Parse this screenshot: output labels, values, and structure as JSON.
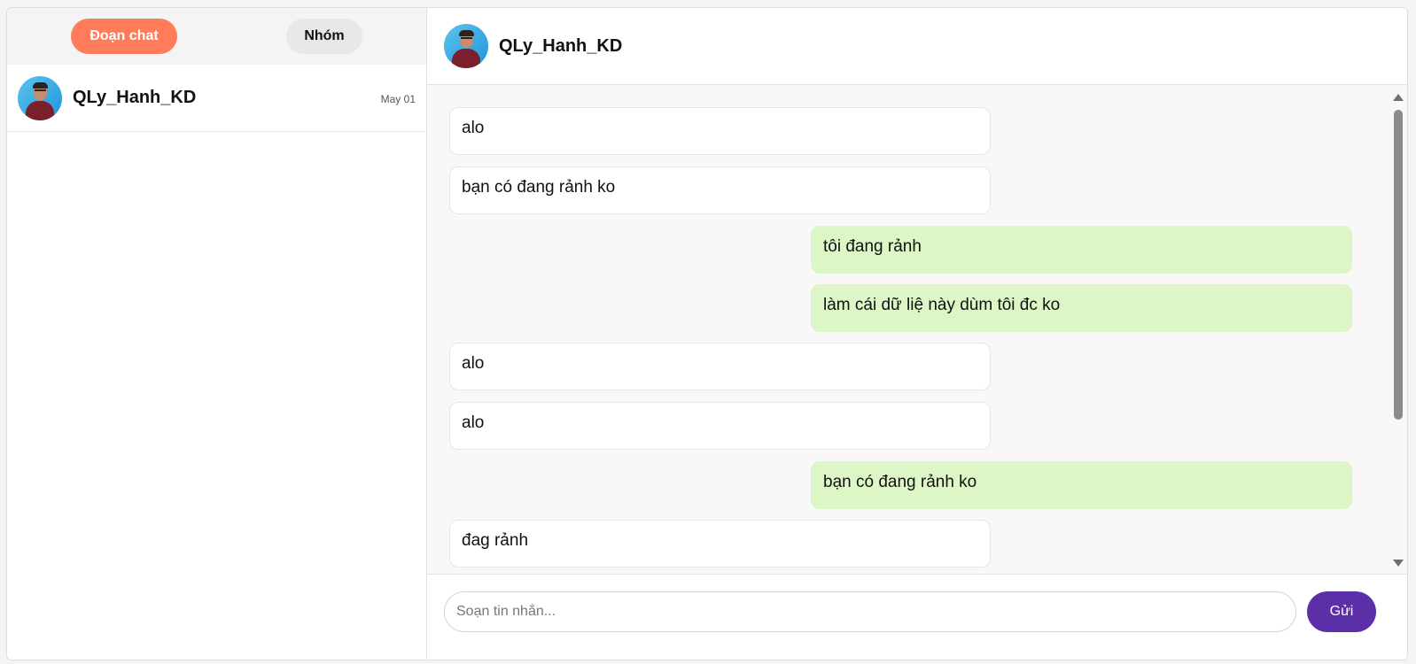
{
  "sidebar": {
    "tabs": [
      {
        "label": "Đoạn chat",
        "active": true
      },
      {
        "label": "Nhóm",
        "active": false
      }
    ],
    "conversations": [
      {
        "name": "QLy_Hanh_KD",
        "date": "May 01",
        "avatar": "person-avatar"
      }
    ]
  },
  "chat": {
    "header": {
      "name": "QLy_Hanh_KD",
      "avatar": "person-avatar"
    },
    "messages": [
      {
        "direction": "in",
        "text": "alo"
      },
      {
        "direction": "in",
        "text": "bạn có đang rảnh ko"
      },
      {
        "direction": "out",
        "text": "tôi đang rảnh"
      },
      {
        "direction": "out",
        "text": "làm cái dữ liệ này dùm tôi đc ko"
      },
      {
        "direction": "in",
        "text": "alo"
      },
      {
        "direction": "in",
        "text": "alo"
      },
      {
        "direction": "out",
        "text": "bạn có đang rảnh ko"
      },
      {
        "direction": "in",
        "text": "đag rảnh"
      }
    ],
    "composer": {
      "placeholder": "Soạn tin nhắn...",
      "value": "",
      "send_label": "Gửi"
    }
  },
  "colors": {
    "accent_tab": "#ff7b59",
    "send_button": "#5b2fa8",
    "outgoing_bubble": "#dcf7c5",
    "incoming_bubble": "#ffffff"
  }
}
